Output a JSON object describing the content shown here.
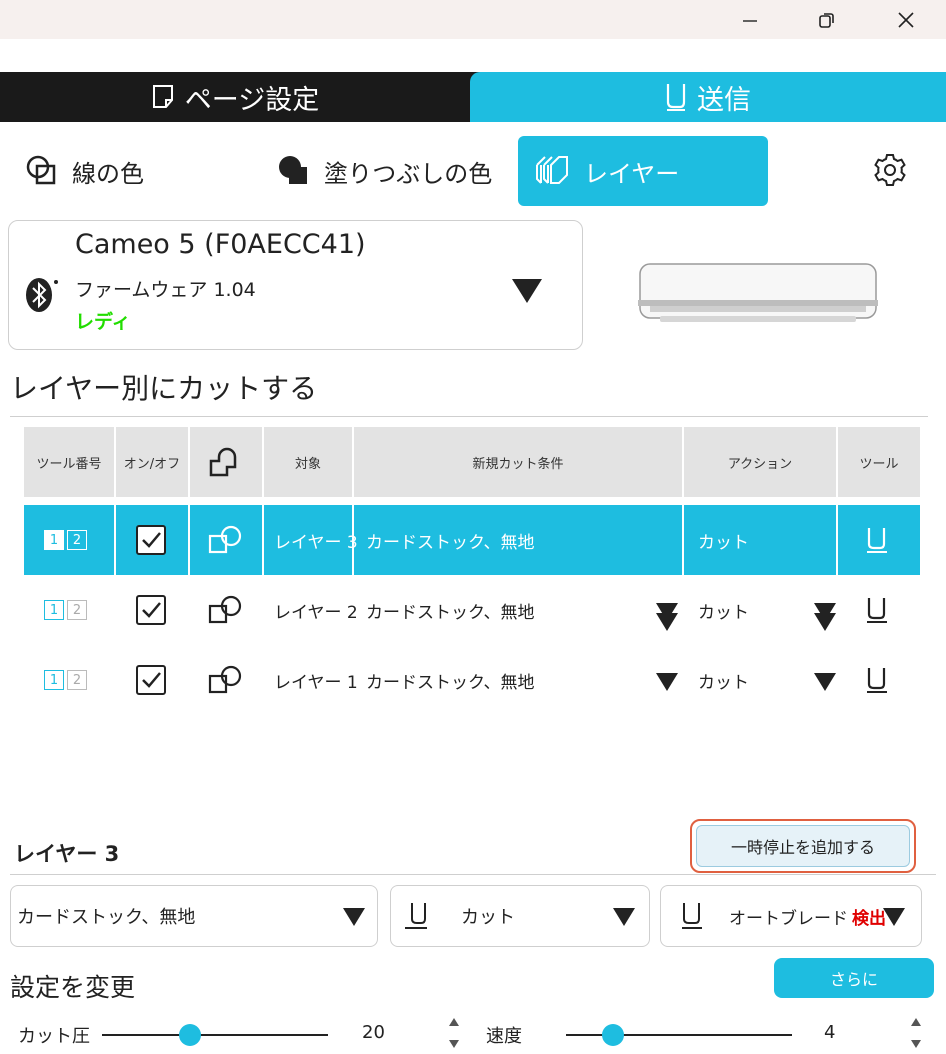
{
  "window": {
    "minimize_icon": "minimize-icon",
    "maximize_icon": "restore-icon",
    "close_icon": "close-icon"
  },
  "main_tabs": [
    {
      "label": "ページ設定",
      "icon": "page-icon"
    },
    {
      "label": "送信",
      "icon": "blade-holder-icon"
    }
  ],
  "sub_tabs": [
    {
      "label": "線の色",
      "icon": "line-color-icon"
    },
    {
      "label": "塗りつぶしの色",
      "icon": "fill-color-icon"
    },
    {
      "label": "レイヤー",
      "icon": "layers-icon"
    }
  ],
  "device": {
    "name": "Cameo 5 (F0AECC41)",
    "firmware": "ファームウェア 1.04",
    "status": "レディ",
    "status_color": "#22dd00"
  },
  "section_title": "レイヤー別にカットする",
  "table": {
    "headers": [
      "ツール番号",
      "オン/オフ",
      "",
      "対象",
      "新規カット条件",
      "アクション",
      "ツール"
    ],
    "rows": [
      {
        "tool_num": [
          "1",
          "2"
        ],
        "checked": true,
        "target": "レイヤー 3",
        "material": "カードストック、無地",
        "action": "カット",
        "selected": true
      },
      {
        "tool_num": [
          "1",
          "2"
        ],
        "checked": true,
        "target": "レイヤー 2",
        "material": "カードストック、無地",
        "action": "カット",
        "selected": false
      },
      {
        "tool_num": [
          "1",
          "2"
        ],
        "checked": true,
        "target": "レイヤー 1",
        "material": "カードストック、無地",
        "action": "カット",
        "selected": false
      }
    ]
  },
  "layer_panel": {
    "title": "レイヤー 3",
    "add_pause_label": "一時停止を追加する",
    "material": "カードストック、無地",
    "action": "カット",
    "blade": "オートブレード",
    "blade_status": "検出",
    "blade_status_color": "#e00000"
  },
  "settings": {
    "title": "設定を変更",
    "more_label": "さらに",
    "pressure_label": "カット圧",
    "pressure_value": "20",
    "pressure_fraction": 0.34,
    "speed_label": "速度",
    "speed_value": "4",
    "speed_fraction": 0.16
  },
  "colors": {
    "accent": "#1ebde0",
    "dark": "#1a1a1a",
    "highlight_outline": "#e06040"
  }
}
